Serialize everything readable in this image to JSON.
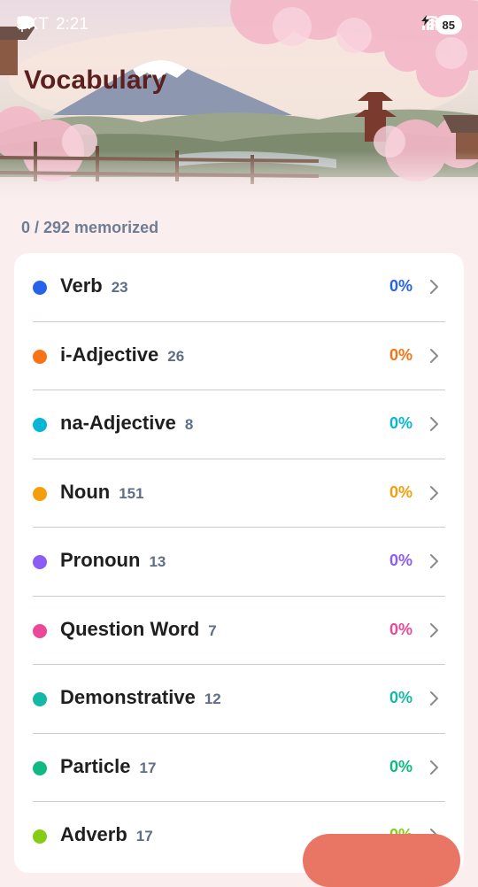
{
  "status_bar": {
    "carrier": "SKT",
    "time": "2:21",
    "battery": "85"
  },
  "header": {
    "title": "Vocabulary"
  },
  "progress": {
    "text": "0 / 292 memorized"
  },
  "categories": [
    {
      "label": "Verb",
      "count": "23",
      "percent": "0%",
      "color": "#2563eb"
    },
    {
      "label": "i-Adjective",
      "count": "26",
      "percent": "0%",
      "color": "#f97316"
    },
    {
      "label": "na-Adjective",
      "count": "8",
      "percent": "0%",
      "color": "#06b6d4"
    },
    {
      "label": "Noun",
      "count": "151",
      "percent": "0%",
      "color": "#f59e0b"
    },
    {
      "label": "Pronoun",
      "count": "13",
      "percent": "0%",
      "color": "#8b5cf6"
    },
    {
      "label": "Question Word",
      "count": "7",
      "percent": "0%",
      "color": "#ec4899"
    },
    {
      "label": "Demonstrative",
      "count": "12",
      "percent": "0%",
      "color": "#14b8a6"
    },
    {
      "label": "Particle",
      "count": "17",
      "percent": "0%",
      "color": "#10b981"
    },
    {
      "label": "Adverb",
      "count": "17",
      "percent": "0%",
      "color": "#84cc16"
    }
  ],
  "colors": {
    "title": "#5a1f1f",
    "background": "#fbeeee",
    "fab": "#e97565"
  }
}
